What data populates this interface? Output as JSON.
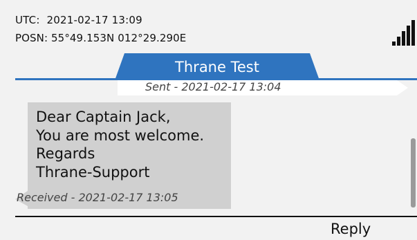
{
  "status_bar": {
    "utc_label": "UTC:",
    "utc_value": "2021-02-17 13:09",
    "posn_label": "POSN:",
    "posn_value": "55°49.153N 012°29.290E",
    "signal_icon": "signal-strength-icon"
  },
  "conversation": {
    "title": "Thrane Test"
  },
  "messages": [
    {
      "direction": "sent",
      "meta": "Sent - 2021-02-17 13:04"
    },
    {
      "direction": "received",
      "lines": [
        "Dear Captain Jack,",
        "You are most welcome.",
        "Regards",
        "Thrane-Support"
      ],
      "meta": "Received - 2021-02-17 13:05"
    }
  ],
  "softkeys": {
    "right_label": "Reply"
  },
  "colors": {
    "accent": "#2f74bf",
    "background": "#f2f2f2",
    "received_bubble": "#d0d0d0",
    "sent_bubble": "#ffffff"
  }
}
